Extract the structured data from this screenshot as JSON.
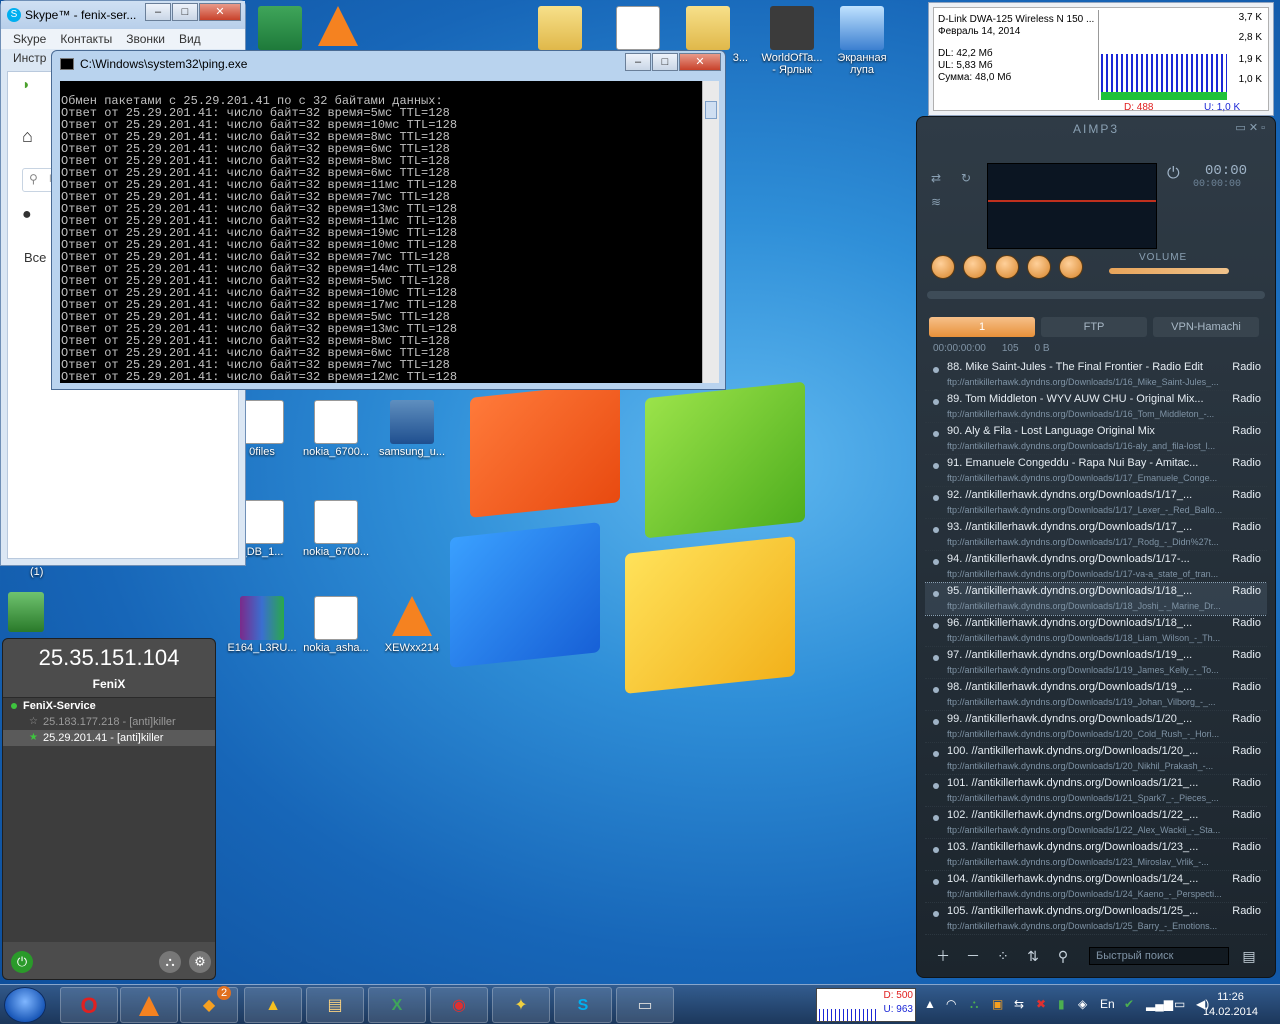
{
  "skype": {
    "title": "Skype™ - fenix-ser...",
    "menu": [
      "Skype",
      "Контакты",
      "Звонки",
      "Вид"
    ],
    "menu2": "Инстр",
    "side_text": "Все",
    "search_partial": "П"
  },
  "ping": {
    "title": "C:\\Windows\\system32\\ping.exe",
    "header": "Обмен пакетами с 25.29.201.41 по с 32 байтами данных:",
    "lines": [
      "Ответ от 25.29.201.41: число байт=32 время=5мс TTL=128",
      "Ответ от 25.29.201.41: число байт=32 время=10мс TTL=128",
      "Ответ от 25.29.201.41: число байт=32 время=8мс TTL=128",
      "Ответ от 25.29.201.41: число байт=32 время=6мс TTL=128",
      "Ответ от 25.29.201.41: число байт=32 время=8мс TTL=128",
      "Ответ от 25.29.201.41: число байт=32 время=6мс TTL=128",
      "Ответ от 25.29.201.41: число байт=32 время=11мс TTL=128",
      "Ответ от 25.29.201.41: число байт=32 время=7мс TTL=128",
      "Ответ от 25.29.201.41: число байт=32 время=13мс TTL=128",
      "Ответ от 25.29.201.41: число байт=32 время=11мс TTL=128",
      "Ответ от 25.29.201.41: число байт=32 время=19мс TTL=128",
      "Ответ от 25.29.201.41: число байт=32 время=10мс TTL=128",
      "Ответ от 25.29.201.41: число байт=32 время=7мс TTL=128",
      "Ответ от 25.29.201.41: число байт=32 время=14мс TTL=128",
      "Ответ от 25.29.201.41: число байт=32 время=5мс TTL=128",
      "Ответ от 25.29.201.41: число байт=32 время=10мс TTL=128",
      "Ответ от 25.29.201.41: число байт=32 время=17мс TTL=128",
      "Ответ от 25.29.201.41: число байт=32 время=5мс TTL=128",
      "Ответ от 25.29.201.41: число байт=32 время=13мс TTL=128",
      "Ответ от 25.29.201.41: число байт=32 время=8мс TTL=128",
      "Ответ от 25.29.201.41: число байт=32 время=6мс TTL=128",
      "Ответ от 25.29.201.41: число байт=32 время=7мс TTL=128",
      "Ответ от 25.29.201.41: число байт=32 время=12мс TTL=128"
    ]
  },
  "desktop_icons": [
    {
      "label": "WorldOfTa...\n- Ярлык",
      "icon": "tank-icon"
    },
    {
      "label": "Экранная\nлупа",
      "icon": "magnifier-icon"
    },
    {
      "label": "0files",
      "icon": "document-icon"
    },
    {
      "label": "nokia_6700...",
      "icon": "pdf-document-icon"
    },
    {
      "label": "samsung_u...",
      "icon": "computer-cd-icon"
    },
    {
      "label": "_DB_1...",
      "icon": "gear-document-icon"
    },
    {
      "label": "nokia_6700...",
      "icon": "pdf-document-icon"
    },
    {
      "label": "E164_L3RU...",
      "icon": "winrar-icon"
    },
    {
      "label": "nokia_asha...",
      "icon": "pdf-document-icon"
    },
    {
      "label": "XEWxx214",
      "icon": "vlc-icon"
    },
    {
      "label": "3...",
      "icon": "folder-icon"
    }
  ],
  "dlink": {
    "name": "D-Link DWA-125 Wireless N 150 ...",
    "date": "Февраль 14, 2014",
    "dl": "DL: 42,2 Мб",
    "ul": "UL: 5,83 Мб",
    "sum": "Сумма: 48,0 Мб",
    "scale": [
      "3,7 K",
      "2,8 K",
      "1,9 K",
      "1,0 K"
    ],
    "d": "D: 488",
    "u": "U: 1,0 K"
  },
  "aimp": {
    "title": "AIMP3",
    "time": "00:00",
    "time2": "00:00:00",
    "volume_label": "VOLUME",
    "tabs": [
      "1",
      "FTP",
      "VPN-Hamachi"
    ],
    "tab_info": [
      "00:00:00:00",
      "105",
      "0 B"
    ],
    "search_placeholder": "Быстрый поиск",
    "tracks": [
      {
        "n": "88. Mike Saint-Jules - The Final Frontier - Radio Edit",
        "tag": "Radio",
        "url": "ftp://antikillerhawk.dyndns.org/Downloads/1/16_Mike_Saint-Jules_..."
      },
      {
        "n": "89. Tom Middleton - WYV AUW CHU - Original Mix...",
        "tag": "Radio",
        "url": "ftp://antikillerhawk.dyndns.org/Downloads/1/16_Tom_Middleton_-..."
      },
      {
        "n": "90. Aly & Fila - Lost Language Original Mix",
        "tag": "Radio",
        "url": "ftp://antikillerhawk.dyndns.org/Downloads/1/16-aly_and_fila-lost_l..."
      },
      {
        "n": "91. Emanuele Congeddu - Rapa Nui Bay - Amitac...",
        "tag": "Radio",
        "url": "ftp://antikillerhawk.dyndns.org/Downloads/1/17_Emanuele_Conge..."
      },
      {
        "n": "92. //antikillerhawk.dyndns.org/Downloads/1/17_...",
        "tag": "Radio",
        "url": "ftp://antikillerhawk.dyndns.org/Downloads/1/17_Lexer_-_Red_Ballo..."
      },
      {
        "n": "93. //antikillerhawk.dyndns.org/Downloads/1/17_...",
        "tag": "Radio",
        "url": "ftp://antikillerhawk.dyndns.org/Downloads/1/17_Rodg_-_Didn%27t..."
      },
      {
        "n": "94. //antikillerhawk.dyndns.org/Downloads/1/17-...",
        "tag": "Radio",
        "url": "ftp://antikillerhawk.dyndns.org/Downloads/1/17-va-a_state_of_tran..."
      },
      {
        "n": "95. //antikillerhawk.dyndns.org/Downloads/1/18_...",
        "tag": "Radio",
        "url": "ftp://antikillerhawk.dyndns.org/Downloads/1/18_Joshi_-_Marine_Dr..."
      },
      {
        "n": "96. //antikillerhawk.dyndns.org/Downloads/1/18_...",
        "tag": "Radio",
        "url": "ftp://antikillerhawk.dyndns.org/Downloads/1/18_Liam_Wilson_-_Th..."
      },
      {
        "n": "97. //antikillerhawk.dyndns.org/Downloads/1/19_...",
        "tag": "Radio",
        "url": "ftp://antikillerhawk.dyndns.org/Downloads/1/19_James_Kelly_-_To..."
      },
      {
        "n": "98. //antikillerhawk.dyndns.org/Downloads/1/19_...",
        "tag": "Radio",
        "url": "ftp://antikillerhawk.dyndns.org/Downloads/1/19_Johan_Vilborg_-_..."
      },
      {
        "n": "99. //antikillerhawk.dyndns.org/Downloads/1/20_...",
        "tag": "Radio",
        "url": "ftp://antikillerhawk.dyndns.org/Downloads/1/20_Cold_Rush_-_Hori..."
      },
      {
        "n": "100. //antikillerhawk.dyndns.org/Downloads/1/20_...",
        "tag": "Radio",
        "url": "ftp://antikillerhawk.dyndns.org/Downloads/1/20_Nikhil_Prakash_-..."
      },
      {
        "n": "101. //antikillerhawk.dyndns.org/Downloads/1/21_...",
        "tag": "Radio",
        "url": "ftp://antikillerhawk.dyndns.org/Downloads/1/21_Spark7_-_Pieces_..."
      },
      {
        "n": "102. //antikillerhawk.dyndns.org/Downloads/1/22_...",
        "tag": "Radio",
        "url": "ftp://antikillerhawk.dyndns.org/Downloads/1/22_Alex_Wackii_-_Sta..."
      },
      {
        "n": "103. //antikillerhawk.dyndns.org/Downloads/1/23_...",
        "tag": "Radio",
        "url": "ftp://antikillerhawk.dyndns.org/Downloads/1/23_Miroslav_Vrlik_-..."
      },
      {
        "n": "104. //antikillerhawk.dyndns.org/Downloads/1/24_...",
        "tag": "Radio",
        "url": "ftp://antikillerhawk.dyndns.org/Downloads/1/24_Kaeno_-_Perspecti..."
      },
      {
        "n": "105. //antikillerhawk.dyndns.org/Downloads/1/25_...",
        "tag": "Radio",
        "url": "ftp://antikillerhawk.dyndns.org/Downloads/1/25_Barry_-_Emotions..."
      }
    ],
    "selected_index": 7
  },
  "fenix": {
    "ip": "25.35.151.104",
    "nick": "FeniX",
    "group": "FeniX-Service",
    "peers": [
      "25.183.177.218 - [anti]killer",
      "25.29.201.41 - [anti]killer"
    ],
    "badge": "(1)"
  },
  "taskbar": {
    "time": "11:26",
    "date": "14.02.2014",
    "lang": "En",
    "net_d": "D: 500",
    "net_u": "U: 963",
    "items": [
      "opera-icon",
      "vlc-icon",
      "badge-icon",
      "triangle-icon",
      "explorer-icon",
      "excel-icon",
      "red-app-icon",
      "emblem-icon",
      "skype-icon",
      "console-icon"
    ],
    "badge_count": "2"
  }
}
